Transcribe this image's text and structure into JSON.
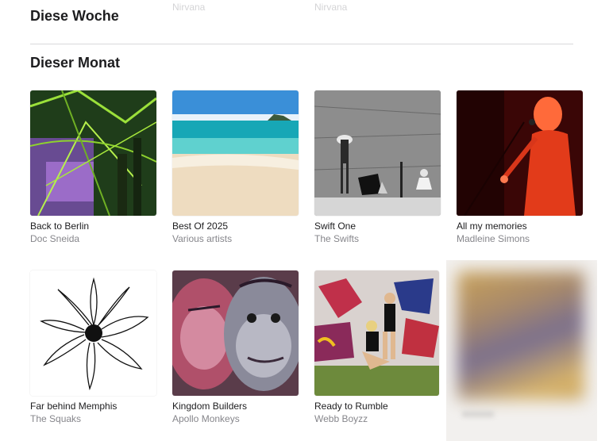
{
  "top_strip": {
    "faded_artist_1": "Nirvana",
    "faded_artist_2": "Nirvana"
  },
  "sections": {
    "this_week": {
      "title": "Diese Woche"
    },
    "this_month": {
      "title": "Dieser Monat"
    }
  },
  "albums": [
    {
      "title": "Back to Berlin",
      "artist": "Doc Sneida",
      "art_icon": "green-abstract-art"
    },
    {
      "title": "Best Of 2025",
      "artist": "Various artists",
      "art_icon": "beach-art"
    },
    {
      "title": "Swift One",
      "artist": "The Swifts",
      "art_icon": "bw-wall-art"
    },
    {
      "title": "All my memories",
      "artist": "Madleine Simons",
      "art_icon": "red-singer-art"
    },
    {
      "title": "Far behind Memphis",
      "artist": "The Squaks",
      "art_icon": "flower-sketch-art"
    },
    {
      "title": "Kingdom Builders",
      "artist": "Apollo Monkeys",
      "art_icon": "gorilla-graffiti-art"
    },
    {
      "title": "Ready to Rumble",
      "artist": "Webb Boyzz",
      "art_icon": "graffiti-women-art"
    }
  ],
  "colors": {
    "accent_text": "#1d1d1f",
    "secondary_text": "#86868b"
  }
}
